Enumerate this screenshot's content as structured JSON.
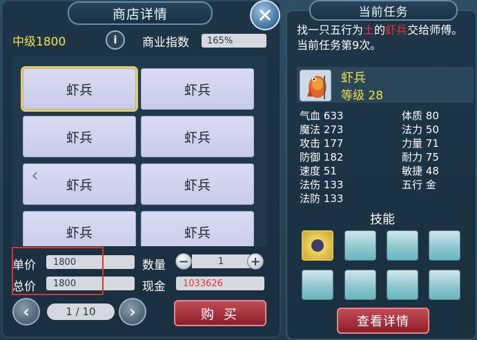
{
  "shop": {
    "title": "商店详情",
    "level": "中级1800",
    "info_icon": "i",
    "business_label": "商业指数",
    "business_value": "165%",
    "items": [
      "虾兵",
      "虾兵",
      "虾兵",
      "虾兵",
      "虾兵",
      "虾兵",
      "虾兵",
      "虾兵"
    ],
    "unit_price_label": "单价",
    "unit_price": "1800",
    "total_price_label": "总价",
    "total_price": "1800",
    "quantity_label": "数量",
    "quantity": "1",
    "cash_label": "现金",
    "cash": "1033626",
    "page": "1 / 10",
    "buy_label": "购 买",
    "colors": {
      "highlight": "#f3e24a",
      "cash": "#e8342c",
      "accent_button": "#a8303b"
    }
  },
  "task": {
    "title": "当前任务",
    "desc_part1": "找一只五行为",
    "desc_element": "土",
    "desc_part2": "的",
    "desc_target": "虾兵",
    "desc_part3": "交给师傅。当前任务第9次。",
    "pet_name": "虾兵",
    "pet_level": "等级 28",
    "stats_left": [
      {
        "label": "气血",
        "value": "633"
      },
      {
        "label": "魔法",
        "value": "273"
      },
      {
        "label": "攻击",
        "value": "177"
      },
      {
        "label": "防御",
        "value": "182"
      },
      {
        "label": "速度",
        "value": "51"
      },
      {
        "label": "法伤",
        "value": "133"
      },
      {
        "label": "法防",
        "value": "133"
      }
    ],
    "stats_right": [
      {
        "label": "体质",
        "value": "80"
      },
      {
        "label": "法力",
        "value": "50"
      },
      {
        "label": "力量",
        "value": "71"
      },
      {
        "label": "耐力",
        "value": "75"
      },
      {
        "label": "敏捷",
        "value": "48"
      },
      {
        "label": "五行",
        "value": "金"
      }
    ],
    "skills_label": "技能",
    "detail_button": "查看详情"
  }
}
